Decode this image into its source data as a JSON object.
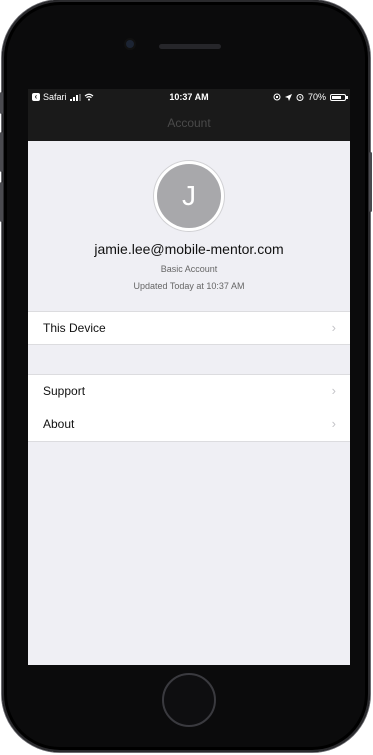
{
  "status_bar": {
    "back_app": "Safari",
    "time": "10:37 AM",
    "battery": "70%",
    "battery_level": 0.7
  },
  "nav": {
    "title": "Account"
  },
  "profile": {
    "avatar_initial": "J",
    "email": "jamie.lee@mobile-mentor.com",
    "account_type": "Basic Account",
    "updated": "Updated Today at 10:37 AM"
  },
  "menu": {
    "this_device": "This Device",
    "support": "Support",
    "about": "About",
    "chevron_icon": "chevron-right-icon"
  }
}
